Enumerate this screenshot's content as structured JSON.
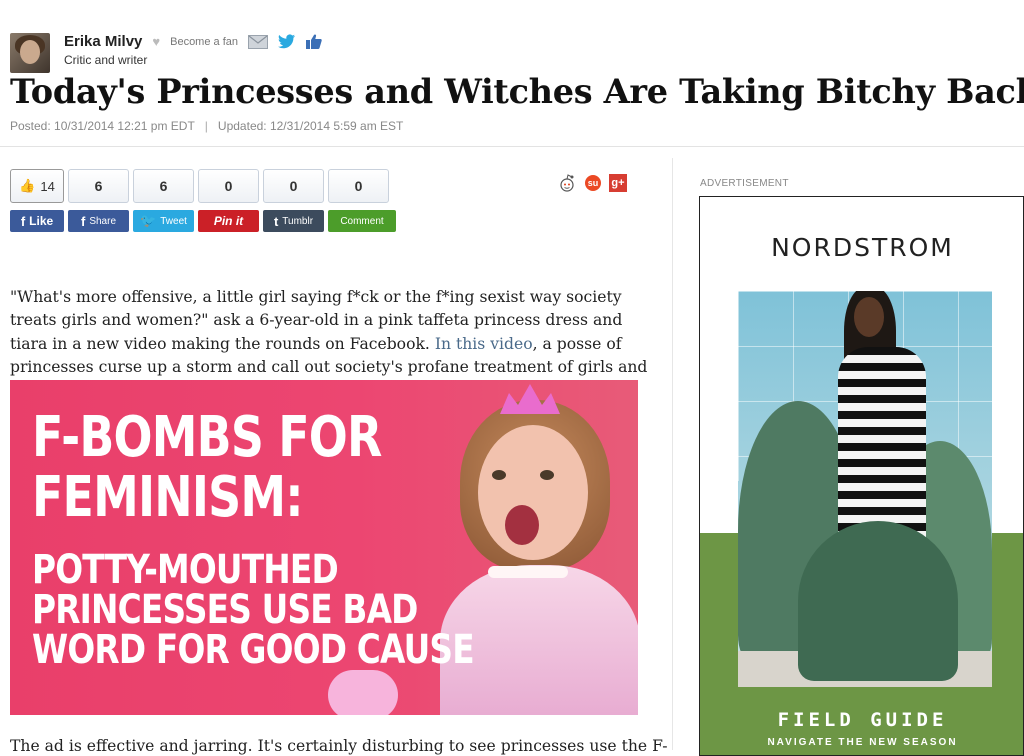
{
  "author": {
    "name": "Erika Milvy",
    "fan_label": "Become a fan",
    "role": "Critic and writer"
  },
  "article": {
    "title": "Today's Princesses and Witches Are Taking Bitchy Back",
    "posted": "Posted: 10/31/2014 12:21 pm EDT",
    "updated": "Updated: 12/31/2014 5:59 am EST",
    "intro_before_link": "\"What's more offensive, a little girl saying f*ck or the f*ing sexist way society treats girls and women?\" ask a 6-year-old in a pink taffeta princess dress and tiara in a new video making the rounds on Facebook. ",
    "intro_link": "In this video",
    "intro_after_link": ", a posse of princesses curse up a storm and call out society's profane treatment of girls and women.",
    "trailing_text": "The ad is effective and jarring. It's certainly disturbing to see princesses use the F-"
  },
  "share": {
    "counts": [
      "14",
      "6",
      "6",
      "0",
      "0",
      "0"
    ],
    "buttons": {
      "like": "Like",
      "facebook": "Share",
      "twitter": "Tweet",
      "pinterest": "Pin it",
      "tumblr": "Tumblr",
      "comment": "Comment"
    }
  },
  "hero": {
    "line1": "F-BOMBS FOR",
    "line2": "FEMINISM:",
    "line3": "POTTY-MOUTHED",
    "line4": "PRINCESSES USE BAD",
    "line5": "WORD FOR GOOD CAUSE"
  },
  "ad": {
    "label": "ADVERTISEMENT",
    "brand": "NORDSTROM",
    "headline": "FIELD GUIDE",
    "subline": "NAVIGATE THE NEW SEASON"
  },
  "colors": {
    "facebook": "#3b5a9a",
    "twitter": "#2aa9e0",
    "pinterest": "#cb2027",
    "tumblr": "#3c4b5d",
    "comment": "#4c9d2a",
    "hero_bg": "#e93f6a",
    "ad_green": "#6d9645"
  }
}
